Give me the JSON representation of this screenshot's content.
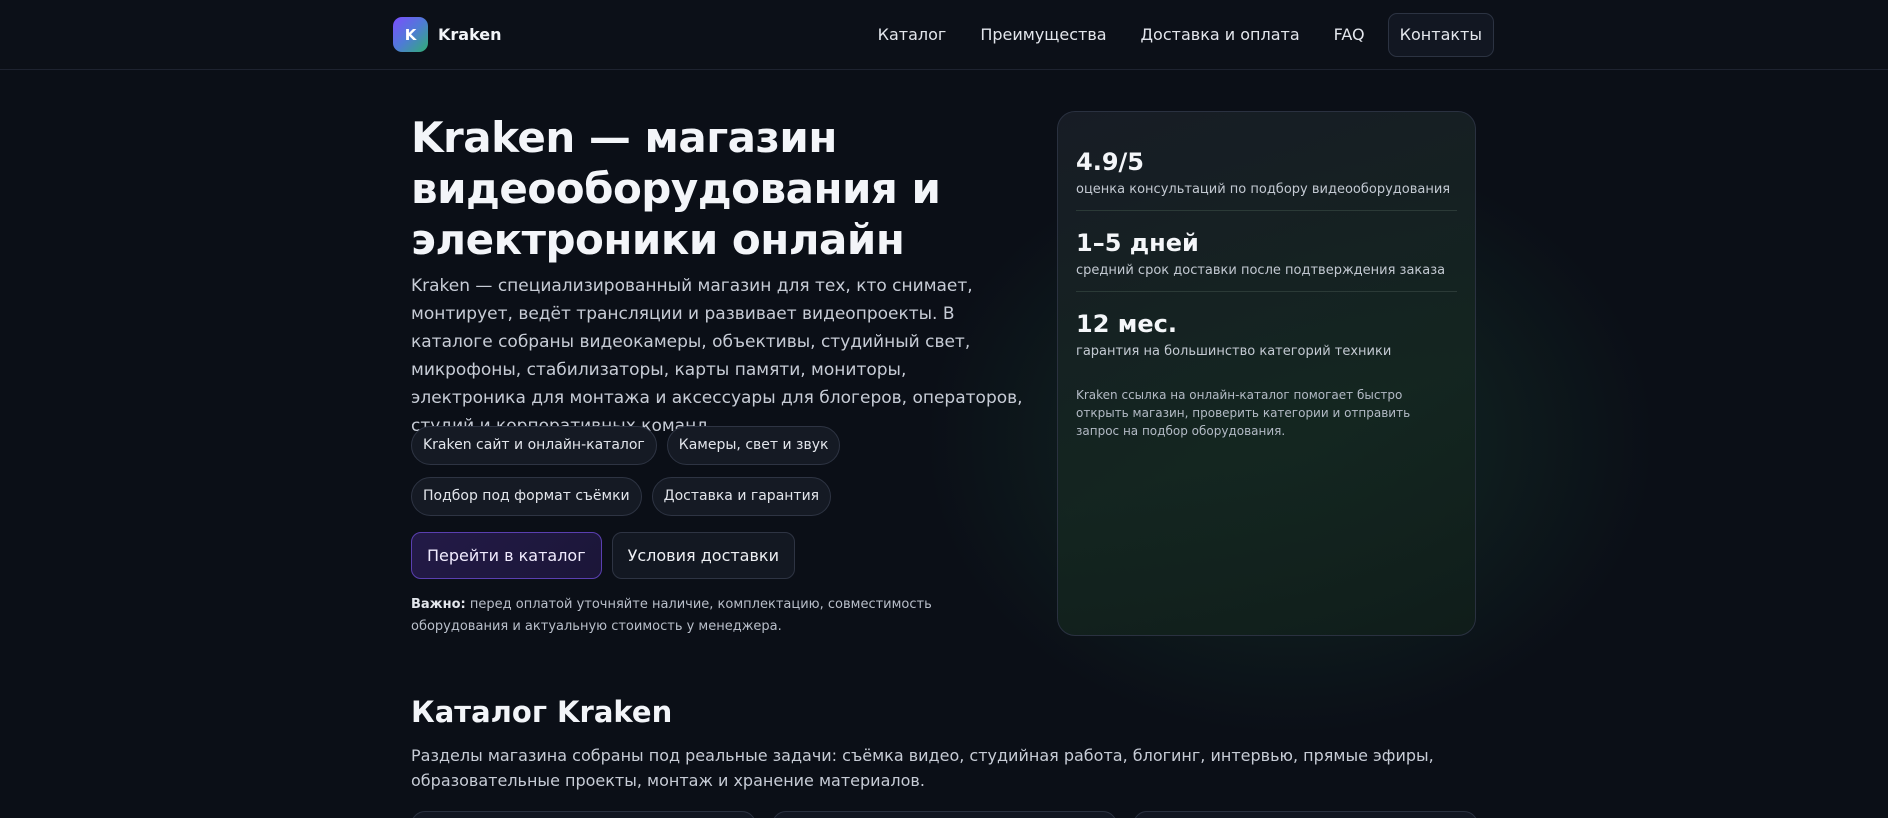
{
  "header": {
    "brand_letter": "K",
    "brand_name": "Kraken",
    "nav": [
      "Каталог",
      "Преимущества",
      "Доставка и оплата",
      "FAQ"
    ],
    "nav_button": "Контакты"
  },
  "hero": {
    "title": "Kraken — магазин видеооборудования и электроники онлайн",
    "lead": "Kraken — специализированный магазин для тех, кто снимает, монтирует, ведёт трансляции и развивает видеопроекты. В каталоге собраны видеокамеры, объективы, студийный свет, микрофоны, стабилизаторы, карты памяти, мониторы, электроника для монтажа и аксессуары для блогеров, операторов, студий и корпоративных команд.",
    "chips": [
      "Kraken сайт и онлайн-каталог",
      "Камеры, свет и звук",
      "Подбор под формат съёмки",
      "Доставка и гарантия"
    ],
    "primary_cta": "Перейти в каталог",
    "secondary_cta": "Условия доставки",
    "note_label": "Важно:",
    "note_text": " перед оплатой уточняйте наличие, комплектацию, совместимость оборудования и актуальную стоимость у менеджера."
  },
  "stats": {
    "items": [
      {
        "value": "4.9/5",
        "label": "оценка консультаций по подбору видеооборудования"
      },
      {
        "value": "1–5 дней",
        "label": "средний срок доставки после подтверждения заказа"
      },
      {
        "value": "12 мес.",
        "label": "гарантия на большинство категорий техники"
      }
    ],
    "note": "Kraken ссылка на онлайн-каталог помогает быстро открыть магазин, проверить категории и отправить запрос на подбор оборудования."
  },
  "catalog": {
    "title": "Каталог Kraken",
    "lead": "Разделы магазина собраны под реальные задачи: съёмка видео, студийная работа, блогинг, интервью, прямые эфиры, образовательные проекты, монтаж и хранение материалов."
  },
  "colors": {
    "background": "#0b0f17",
    "accent": "#5a3fb0",
    "glow": "#226e46"
  }
}
